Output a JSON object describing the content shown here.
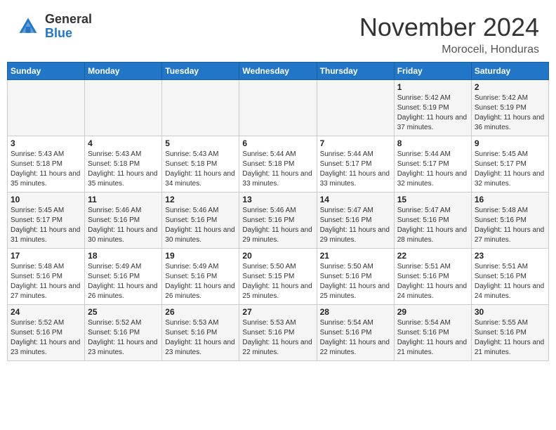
{
  "logo": {
    "general": "General",
    "blue": "Blue"
  },
  "header": {
    "month": "November 2024",
    "location": "Moroceli, Honduras"
  },
  "weekdays": [
    "Sunday",
    "Monday",
    "Tuesday",
    "Wednesday",
    "Thursday",
    "Friday",
    "Saturday"
  ],
  "weeks": [
    [
      {
        "day": "",
        "sunrise": "",
        "sunset": "",
        "daylight": ""
      },
      {
        "day": "",
        "sunrise": "",
        "sunset": "",
        "daylight": ""
      },
      {
        "day": "",
        "sunrise": "",
        "sunset": "",
        "daylight": ""
      },
      {
        "day": "",
        "sunrise": "",
        "sunset": "",
        "daylight": ""
      },
      {
        "day": "",
        "sunrise": "",
        "sunset": "",
        "daylight": ""
      },
      {
        "day": "1",
        "sunrise": "Sunrise: 5:42 AM",
        "sunset": "Sunset: 5:19 PM",
        "daylight": "Daylight: 11 hours and 37 minutes."
      },
      {
        "day": "2",
        "sunrise": "Sunrise: 5:42 AM",
        "sunset": "Sunset: 5:19 PM",
        "daylight": "Daylight: 11 hours and 36 minutes."
      }
    ],
    [
      {
        "day": "3",
        "sunrise": "Sunrise: 5:43 AM",
        "sunset": "Sunset: 5:18 PM",
        "daylight": "Daylight: 11 hours and 35 minutes."
      },
      {
        "day": "4",
        "sunrise": "Sunrise: 5:43 AM",
        "sunset": "Sunset: 5:18 PM",
        "daylight": "Daylight: 11 hours and 35 minutes."
      },
      {
        "day": "5",
        "sunrise": "Sunrise: 5:43 AM",
        "sunset": "Sunset: 5:18 PM",
        "daylight": "Daylight: 11 hours and 34 minutes."
      },
      {
        "day": "6",
        "sunrise": "Sunrise: 5:44 AM",
        "sunset": "Sunset: 5:18 PM",
        "daylight": "Daylight: 11 hours and 33 minutes."
      },
      {
        "day": "7",
        "sunrise": "Sunrise: 5:44 AM",
        "sunset": "Sunset: 5:17 PM",
        "daylight": "Daylight: 11 hours and 33 minutes."
      },
      {
        "day": "8",
        "sunrise": "Sunrise: 5:44 AM",
        "sunset": "Sunset: 5:17 PM",
        "daylight": "Daylight: 11 hours and 32 minutes."
      },
      {
        "day": "9",
        "sunrise": "Sunrise: 5:45 AM",
        "sunset": "Sunset: 5:17 PM",
        "daylight": "Daylight: 11 hours and 32 minutes."
      }
    ],
    [
      {
        "day": "10",
        "sunrise": "Sunrise: 5:45 AM",
        "sunset": "Sunset: 5:17 PM",
        "daylight": "Daylight: 11 hours and 31 minutes."
      },
      {
        "day": "11",
        "sunrise": "Sunrise: 5:46 AM",
        "sunset": "Sunset: 5:16 PM",
        "daylight": "Daylight: 11 hours and 30 minutes."
      },
      {
        "day": "12",
        "sunrise": "Sunrise: 5:46 AM",
        "sunset": "Sunset: 5:16 PM",
        "daylight": "Daylight: 11 hours and 30 minutes."
      },
      {
        "day": "13",
        "sunrise": "Sunrise: 5:46 AM",
        "sunset": "Sunset: 5:16 PM",
        "daylight": "Daylight: 11 hours and 29 minutes."
      },
      {
        "day": "14",
        "sunrise": "Sunrise: 5:47 AM",
        "sunset": "Sunset: 5:16 PM",
        "daylight": "Daylight: 11 hours and 29 minutes."
      },
      {
        "day": "15",
        "sunrise": "Sunrise: 5:47 AM",
        "sunset": "Sunset: 5:16 PM",
        "daylight": "Daylight: 11 hours and 28 minutes."
      },
      {
        "day": "16",
        "sunrise": "Sunrise: 5:48 AM",
        "sunset": "Sunset: 5:16 PM",
        "daylight": "Daylight: 11 hours and 27 minutes."
      }
    ],
    [
      {
        "day": "17",
        "sunrise": "Sunrise: 5:48 AM",
        "sunset": "Sunset: 5:16 PM",
        "daylight": "Daylight: 11 hours and 27 minutes."
      },
      {
        "day": "18",
        "sunrise": "Sunrise: 5:49 AM",
        "sunset": "Sunset: 5:16 PM",
        "daylight": "Daylight: 11 hours and 26 minutes."
      },
      {
        "day": "19",
        "sunrise": "Sunrise: 5:49 AM",
        "sunset": "Sunset: 5:16 PM",
        "daylight": "Daylight: 11 hours and 26 minutes."
      },
      {
        "day": "20",
        "sunrise": "Sunrise: 5:50 AM",
        "sunset": "Sunset: 5:15 PM",
        "daylight": "Daylight: 11 hours and 25 minutes."
      },
      {
        "day": "21",
        "sunrise": "Sunrise: 5:50 AM",
        "sunset": "Sunset: 5:16 PM",
        "daylight": "Daylight: 11 hours and 25 minutes."
      },
      {
        "day": "22",
        "sunrise": "Sunrise: 5:51 AM",
        "sunset": "Sunset: 5:16 PM",
        "daylight": "Daylight: 11 hours and 24 minutes."
      },
      {
        "day": "23",
        "sunrise": "Sunrise: 5:51 AM",
        "sunset": "Sunset: 5:16 PM",
        "daylight": "Daylight: 11 hours and 24 minutes."
      }
    ],
    [
      {
        "day": "24",
        "sunrise": "Sunrise: 5:52 AM",
        "sunset": "Sunset: 5:16 PM",
        "daylight": "Daylight: 11 hours and 23 minutes."
      },
      {
        "day": "25",
        "sunrise": "Sunrise: 5:52 AM",
        "sunset": "Sunset: 5:16 PM",
        "daylight": "Daylight: 11 hours and 23 minutes."
      },
      {
        "day": "26",
        "sunrise": "Sunrise: 5:53 AM",
        "sunset": "Sunset: 5:16 PM",
        "daylight": "Daylight: 11 hours and 23 minutes."
      },
      {
        "day": "27",
        "sunrise": "Sunrise: 5:53 AM",
        "sunset": "Sunset: 5:16 PM",
        "daylight": "Daylight: 11 hours and 22 minutes."
      },
      {
        "day": "28",
        "sunrise": "Sunrise: 5:54 AM",
        "sunset": "Sunset: 5:16 PM",
        "daylight": "Daylight: 11 hours and 22 minutes."
      },
      {
        "day": "29",
        "sunrise": "Sunrise: 5:54 AM",
        "sunset": "Sunset: 5:16 PM",
        "daylight": "Daylight: 11 hours and 21 minutes."
      },
      {
        "day": "30",
        "sunrise": "Sunrise: 5:55 AM",
        "sunset": "Sunset: 5:16 PM",
        "daylight": "Daylight: 11 hours and 21 minutes."
      }
    ]
  ]
}
